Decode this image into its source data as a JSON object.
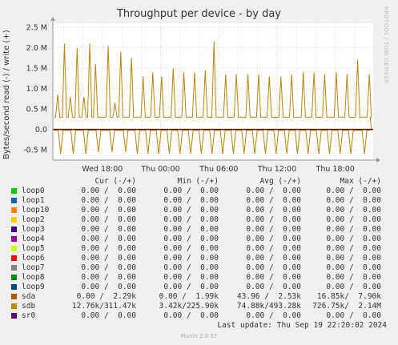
{
  "chart_data": {
    "type": "line",
    "title": "Throughput per device - by day",
    "ylabel": "Bytes/second read (-) / write (+)",
    "yticks": [
      {
        "v": 2500000,
        "label": "2.5 M"
      },
      {
        "v": 2000000,
        "label": "2.0 M"
      },
      {
        "v": 1500000,
        "label": "1.5 M"
      },
      {
        "v": 1000000,
        "label": "1.0 M"
      },
      {
        "v": 500000,
        "label": "0.5 M"
      },
      {
        "v": 0,
        "label": "0.0"
      },
      {
        "v": -500000,
        "label": "-0.5 M"
      }
    ],
    "xticks": [
      "Wed 18:00",
      "Thu 00:00",
      "Thu 06:00",
      "Thu 12:00",
      "Thu 18:00"
    ],
    "xrange_hours": [
      -5.1,
      27.9
    ],
    "xtick_hours": [
      0,
      6,
      12,
      18,
      24
    ],
    "ylim": [
      -750000,
      2600000
    ],
    "grid": true,
    "series": [
      {
        "name": "sdb",
        "color": "#b8860b",
        "base_write": 300000,
        "base_read": -20000,
        "write_peaks": [
          {
            "h": -4.6,
            "v": 850000
          },
          {
            "h": -3.9,
            "v": 2100000
          },
          {
            "h": -3.3,
            "v": 800000
          },
          {
            "h": -2.6,
            "v": 2000000
          },
          {
            "h": -1.9,
            "v": 800000
          },
          {
            "h": -1.3,
            "v": 2100000
          },
          {
            "h": -0.7,
            "v": 1600000
          },
          {
            "h": 0.6,
            "v": 2050000
          },
          {
            "h": 1.3,
            "v": 650000
          },
          {
            "h": 1.9,
            "v": 1900000
          },
          {
            "h": 3.0,
            "v": 1750000
          },
          {
            "h": 4.2,
            "v": 1300000
          },
          {
            "h": 5.2,
            "v": 1400000
          },
          {
            "h": 6.1,
            "v": 1300000
          },
          {
            "h": 7.3,
            "v": 1500000
          },
          {
            "h": 8.4,
            "v": 1400000
          },
          {
            "h": 9.5,
            "v": 1400000
          },
          {
            "h": 10.6,
            "v": 1450000
          },
          {
            "h": 11.5,
            "v": 2150000
          },
          {
            "h": 12.7,
            "v": 1350000
          },
          {
            "h": 13.8,
            "v": 1350000
          },
          {
            "h": 15.0,
            "v": 1350000
          },
          {
            "h": 16.1,
            "v": 1350000
          },
          {
            "h": 17.2,
            "v": 1300000
          },
          {
            "h": 18.4,
            "v": 1300000
          },
          {
            "h": 19.5,
            "v": 1350000
          },
          {
            "h": 20.7,
            "v": 1400000
          },
          {
            "h": 21.8,
            "v": 1400000
          },
          {
            "h": 22.9,
            "v": 1350000
          },
          {
            "h": 24.1,
            "v": 1400000
          },
          {
            "h": 25.2,
            "v": 1350000
          },
          {
            "h": 26.3,
            "v": 1700000
          },
          {
            "h": 27.5,
            "v": 1350000
          }
        ],
        "read_dips": [
          {
            "h": -4.3,
            "v": -600000
          },
          {
            "h": -3.0,
            "v": -600000
          },
          {
            "h": -1.7,
            "v": -600000
          },
          {
            "h": -0.4,
            "v": -550000
          },
          {
            "h": 1.0,
            "v": -550000
          },
          {
            "h": 2.4,
            "v": -550000
          },
          {
            "h": 3.6,
            "v": -600000
          },
          {
            "h": 4.7,
            "v": -600000
          },
          {
            "h": 5.8,
            "v": -600000
          },
          {
            "h": 6.9,
            "v": -600000
          },
          {
            "h": 8.0,
            "v": -600000
          },
          {
            "h": 9.1,
            "v": -600000
          },
          {
            "h": 10.2,
            "v": -600000
          },
          {
            "h": 11.3,
            "v": -600000
          },
          {
            "h": 12.4,
            "v": -600000
          },
          {
            "h": 13.5,
            "v": -600000
          },
          {
            "h": 14.6,
            "v": -600000
          },
          {
            "h": 15.7,
            "v": -600000
          },
          {
            "h": 16.8,
            "v": -600000
          },
          {
            "h": 17.9,
            "v": -600000
          },
          {
            "h": 19.0,
            "v": -600000
          },
          {
            "h": 20.1,
            "v": -600000
          },
          {
            "h": 21.2,
            "v": -600000
          },
          {
            "h": 22.3,
            "v": -600000
          },
          {
            "h": 23.4,
            "v": -600000
          },
          {
            "h": 24.5,
            "v": -600000
          },
          {
            "h": 25.6,
            "v": -600000
          },
          {
            "h": 27.0,
            "v": -600000
          }
        ]
      }
    ]
  },
  "legend": {
    "headers": [
      "Cur (-/+)",
      "Min (-/+)",
      "Avg (-/+)",
      "Max (-/+)"
    ],
    "rows": [
      {
        "name": "loop0",
        "color": "#00cc00",
        "cur": "0.00 /  0.00",
        "min": "0.00 /  0.00",
        "avg": "0.00 /  0.00",
        "max": "0.00 /  0.00"
      },
      {
        "name": "loop1",
        "color": "#0066b3",
        "cur": "0.00 /  0.00",
        "min": "0.00 /  0.00",
        "avg": "0.00 /  0.00",
        "max": "0.00 /  0.00"
      },
      {
        "name": "loop10",
        "color": "#ff8000",
        "cur": "0.00 /  0.00",
        "min": "0.00 /  0.00",
        "avg": "0.00 /  0.00",
        "max": "0.00 /  0.00"
      },
      {
        "name": "loop2",
        "color": "#ffcc00",
        "cur": "0.00 /  0.00",
        "min": "0.00 /  0.00",
        "avg": "0.00 /  0.00",
        "max": "0.00 /  0.00"
      },
      {
        "name": "loop3",
        "color": "#330099",
        "cur": "0.00 /  0.00",
        "min": "0.00 /  0.00",
        "avg": "0.00 /  0.00",
        "max": "0.00 /  0.00"
      },
      {
        "name": "loop4",
        "color": "#990099",
        "cur": "0.00 /  0.00",
        "min": "0.00 /  0.00",
        "avg": "0.00 /  0.00",
        "max": "0.00 /  0.00"
      },
      {
        "name": "loop5",
        "color": "#ccff00",
        "cur": "0.00 /  0.00",
        "min": "0.00 /  0.00",
        "avg": "0.00 /  0.00",
        "max": "0.00 /  0.00"
      },
      {
        "name": "loop6",
        "color": "#ff0000",
        "cur": "0.00 /  0.00",
        "min": "0.00 /  0.00",
        "avg": "0.00 /  0.00",
        "max": "0.00 /  0.00"
      },
      {
        "name": "loop7",
        "color": "#808080",
        "cur": "0.00 /  0.00",
        "min": "0.00 /  0.00",
        "avg": "0.00 /  0.00",
        "max": "0.00 /  0.00"
      },
      {
        "name": "loop8",
        "color": "#008f00",
        "cur": "0.00 /  0.00",
        "min": "0.00 /  0.00",
        "avg": "0.00 /  0.00",
        "max": "0.00 /  0.00"
      },
      {
        "name": "loop9",
        "color": "#00487d",
        "cur": "0.00 /  0.00",
        "min": "0.00 /  0.00",
        "avg": "0.00 /  0.00",
        "max": "0.00 /  0.00"
      },
      {
        "name": "sda",
        "color": "#b35a00",
        "cur": "0.00 /  2.29k",
        "min": "0.00 /  1.99k",
        "avg": "43.96 /  2.53k",
        "max": "16.85k/  7.90k"
      },
      {
        "name": "sdb",
        "color": "#b38f00",
        "cur": "12.76k/311.47k",
        "min": "3.42k/225.90k",
        "avg": "74.88k/493.28k",
        "max": "726.75k/  2.14M"
      },
      {
        "name": "sr0",
        "color": "#6b006b",
        "cur": "0.00 /  0.00",
        "min": "0.00 /  0.00",
        "avg": "0.00 /  0.00",
        "max": "0.00 /  0.00"
      }
    ]
  },
  "last_update": "Last update: Thu Sep 19 22:20:02 2024",
  "side_label": "RRDTOOL / TOBI OETIKER",
  "version": "Munin 2.0.57"
}
